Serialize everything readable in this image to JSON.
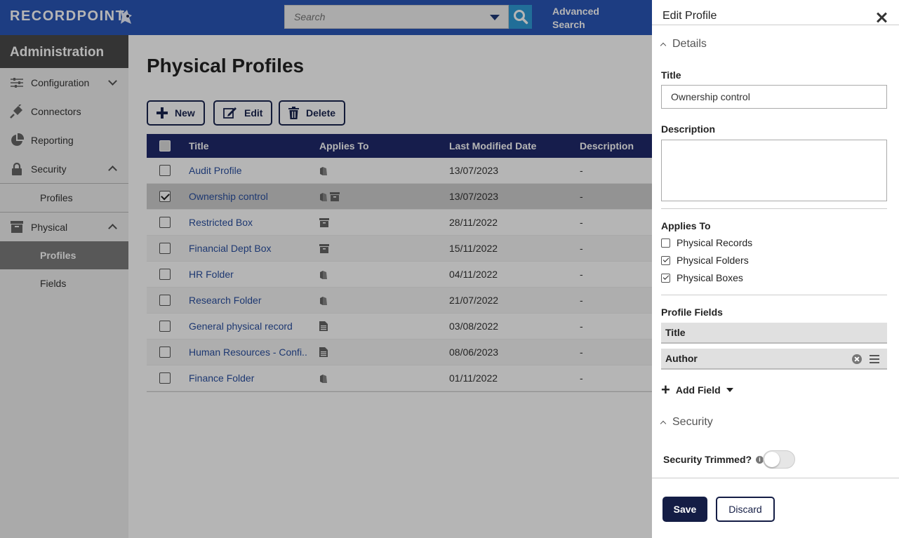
{
  "header": {
    "logo_text": "RECORDPOINT",
    "search_placeholder": "Search",
    "advanced_search_label": "Advanced Search",
    "brand_color": "#2a56b8"
  },
  "sidebar": {
    "title": "Administration",
    "items": [
      {
        "label": "Configuration",
        "icon": "sliders-icon"
      },
      {
        "label": "Connectors",
        "icon": "plug-icon"
      },
      {
        "label": "Reporting",
        "icon": "pie-chart-icon"
      },
      {
        "label": "Security",
        "icon": "lock-icon"
      },
      {
        "label": "Profiles"
      },
      {
        "label": "Physical",
        "icon": "archive-box-icon"
      },
      {
        "label": "Profiles"
      },
      {
        "label": "Fields"
      }
    ]
  },
  "main": {
    "title": "Physical Profiles",
    "toolbar": {
      "new_label": "New",
      "edit_label": "Edit",
      "delete_label": "Delete"
    },
    "columns": [
      "Title",
      "Applies To",
      "Last Modified Date",
      "Description"
    ],
    "rows": [
      {
        "title": "Audit Profile",
        "applies": [
          "folder-icon"
        ],
        "date": "13/07/2023",
        "desc": "-",
        "checked": false
      },
      {
        "title": "Ownership control",
        "applies": [
          "folder-icon",
          "box-icon"
        ],
        "date": "13/07/2023",
        "desc": "-",
        "checked": true
      },
      {
        "title": "Restricted Box",
        "applies": [
          "box-icon"
        ],
        "date": "28/11/2022",
        "desc": "-",
        "checked": false
      },
      {
        "title": "Financial Dept Box",
        "applies": [
          "box-icon"
        ],
        "date": "15/11/2022",
        "desc": "-",
        "checked": false
      },
      {
        "title": "HR Folder",
        "applies": [
          "folder-icon"
        ],
        "date": "04/11/2022",
        "desc": "-",
        "checked": false
      },
      {
        "title": "Research Folder",
        "applies": [
          "folder-icon"
        ],
        "date": "21/07/2022",
        "desc": "-",
        "checked": false
      },
      {
        "title": "General physical record",
        "applies": [
          "document-icon"
        ],
        "date": "03/08/2022",
        "desc": "-",
        "checked": false
      },
      {
        "title": "Human Resources - Confi...",
        "applies": [
          "document-icon"
        ],
        "date": "08/06/2023",
        "desc": "-",
        "checked": false
      },
      {
        "title": "Finance Folder",
        "applies": [
          "folder-icon"
        ],
        "date": "01/11/2022",
        "desc": "-",
        "checked": false
      }
    ]
  },
  "panel": {
    "title": "Edit Profile",
    "details_label": "Details",
    "title_label": "Title",
    "title_value": "Ownership control",
    "description_label": "Description",
    "description_value": "",
    "applies_to_label": "Applies To",
    "applies_options": [
      {
        "label": "Physical Records",
        "checked": false
      },
      {
        "label": "Physical Folders",
        "checked": true
      },
      {
        "label": "Physical Boxes",
        "checked": true
      }
    ],
    "profile_fields_label": "Profile Fields",
    "fields": [
      "Title",
      "Author"
    ],
    "add_field_label": "Add Field",
    "security_label": "Security",
    "security_trimmed_label": "Security Trimmed?",
    "security_trimmed_on": false,
    "save_label": "Save",
    "discard_label": "Discard"
  }
}
